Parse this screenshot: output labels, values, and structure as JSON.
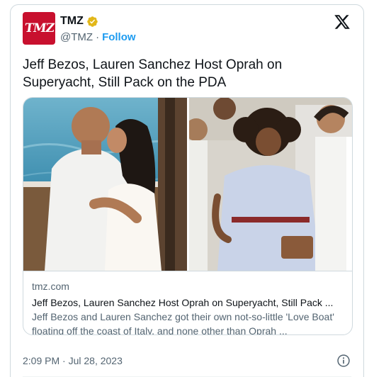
{
  "account": {
    "avatar_text": "TMZ",
    "display_name": "TMZ",
    "handle": "@TMZ",
    "separator": "·",
    "follow_label": "Follow",
    "verified_color": "#e2b719"
  },
  "tweet": {
    "text": "Jeff Bezos, Lauren Sanchez Host Oprah on Superyacht, Still Pack on the PDA"
  },
  "link_card": {
    "domain": "tmz.com",
    "title": "Jeff Bezos, Lauren Sanchez Host Oprah on Superyacht, Still Pack ...",
    "description": "Jeff Bezos and Lauren Sanchez got their own not-so-little 'Love Boat' floating off the coast of Italy, and none other than Oprah ..."
  },
  "footer": {
    "timestamp": "2:09 PM · Jul 28, 2023"
  },
  "icons": {
    "brand": "x-logo-icon",
    "info": "info-icon",
    "verified": "verified-badge-icon"
  },
  "colors": {
    "link_blue": "#1d9bf0",
    "muted": "#536471",
    "border": "#cfd9de",
    "tmz_red": "#c8102e"
  }
}
